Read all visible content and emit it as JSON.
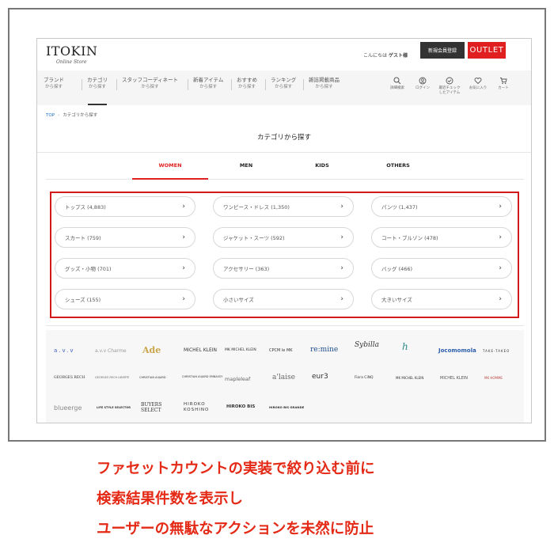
{
  "header": {
    "logo": "ITOKIN",
    "logo_sub": "Online Store",
    "greeting_prefix": "こんにちは",
    "greeting_user": "ゲスト様",
    "register_label": "新規会員登録",
    "outlet_label": "OUTLET"
  },
  "nav": {
    "items": [
      {
        "l1": "ブランド",
        "l2": "から探す"
      },
      {
        "l1": "カテゴリ",
        "l2": "から探す"
      },
      {
        "l1": "スタッフコーディネート",
        "l2": "から探す"
      },
      {
        "l1": "新着アイテム",
        "l2": "から探す"
      },
      {
        "l1": "おすすめ",
        "l2": "から探す"
      },
      {
        "l1": "ランキング",
        "l2": "から探す"
      },
      {
        "l1": "雑誌掲載商品",
        "l2": "から探す"
      }
    ],
    "icons": [
      {
        "name": "search-icon",
        "label": "詳細検索"
      },
      {
        "name": "login-icon",
        "label": "ログイン"
      },
      {
        "name": "checked-items-icon",
        "label": "最近チェック\nしたアイテム"
      },
      {
        "name": "heart-icon",
        "label": "お気に入り"
      },
      {
        "name": "cart-icon",
        "label": "カート"
      }
    ]
  },
  "breadcrumb": {
    "top": "TOP",
    "current": "カテゴリから探す"
  },
  "page_title": "カテゴリから探す",
  "tabs": [
    "WOMEN",
    "MEN",
    "KIDS",
    "OTHERS"
  ],
  "categories": [
    "トップス (4,883)",
    "ワンピース・ドレス (1,350)",
    "パンツ (1,437)",
    "スカート (759)",
    "ジャケット・スーツ (592)",
    "コート・ブルゾン (478)",
    "グッズ・小物 (701)",
    "アクセサリー (363)",
    "バッグ (466)",
    "シューズ (155)",
    "小さいサイズ",
    "大きいサイズ"
  ],
  "brands": [
    "a.v.v",
    "a.v.v Charme",
    "Ade",
    "MICHEL KLEIN",
    "MK MICHEL KLEIN",
    "CPCM le MK",
    "re:mine",
    "Sybilla",
    "h",
    "Jocomomola",
    "TAKE-TAKEO",
    "GEORGES RECH",
    "GEORGES RECH LIBERTÉ",
    "CHRISTIAN AUJARD",
    "CHRISTIAN AUJARD EMBASSY",
    "mapleleaf",
    "a'laise",
    "eur3",
    "Fiora CiNQ",
    "MK MICHEL KLEIN",
    "MICHEL KLEIN",
    "MK HOMME",
    "blueerge",
    "LIFE STYLE SELECTOR",
    "BUYERS SELECT",
    "HIROKO KOSHINO",
    "HIROKO BIS",
    "HIROKO BIS GRANDE"
  ],
  "caption": [
    "ファセットカウントの実装で絞り込む前に",
    "検索結果件数を表示し",
    "ユーザーの無駄なアクションを未然に防止"
  ],
  "colors": {
    "accent": "#e02020",
    "caption": "#e42a16",
    "dark_button": "#333333"
  }
}
